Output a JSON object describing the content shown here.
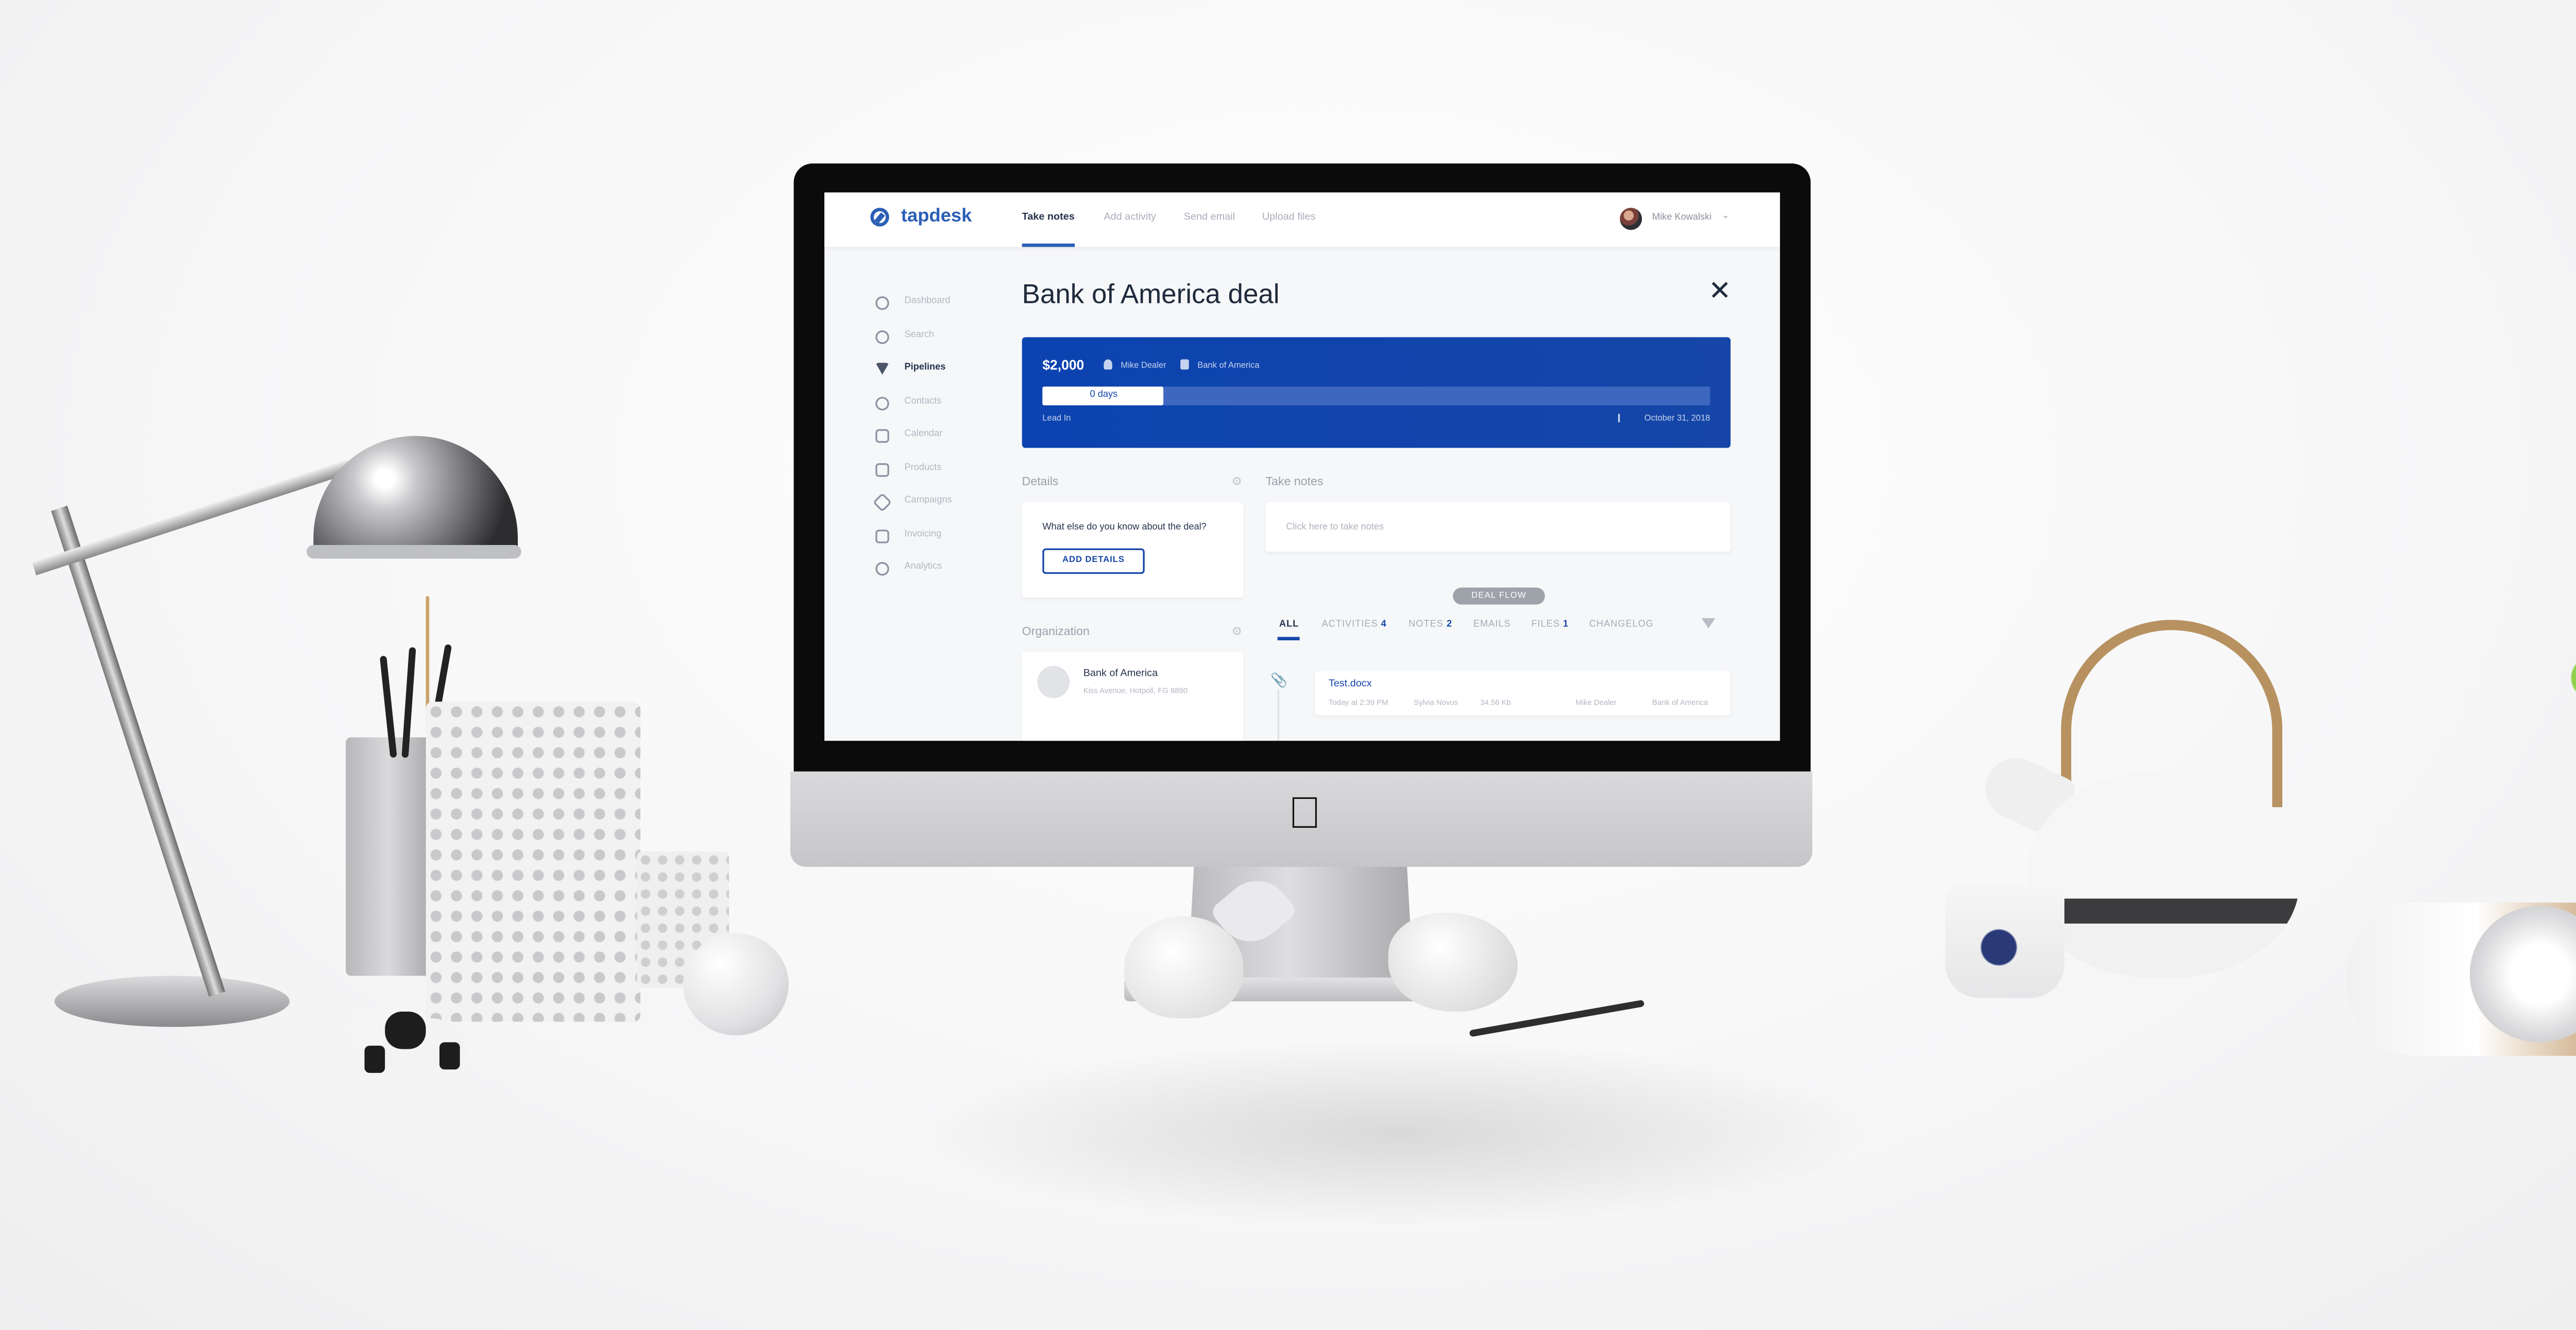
{
  "app": {
    "logo_text": "tapdesk",
    "brand_color": "#2b5fb6",
    "accent_color": "#1546a8"
  },
  "header": {
    "tabs": [
      {
        "label": "Take notes",
        "active": true
      },
      {
        "label": "Add activity",
        "active": false
      },
      {
        "label": "Send email",
        "active": false
      },
      {
        "label": "Upload files",
        "active": false
      }
    ],
    "user_name": "Mike Kowalski",
    "user_caret_icon": "chevron-down-icon"
  },
  "sidebar": {
    "items": [
      {
        "label": "Dashboard",
        "icon": "dashboard-icon",
        "active": false
      },
      {
        "label": "Search",
        "icon": "search-icon",
        "active": false
      },
      {
        "label": "Pipelines",
        "icon": "funnel-icon",
        "active": true
      },
      {
        "label": "Contacts",
        "icon": "contacts-icon",
        "active": false
      },
      {
        "label": "Calendar",
        "icon": "calendar-icon",
        "active": false
      },
      {
        "label": "Products",
        "icon": "box-icon",
        "active": false
      },
      {
        "label": "Campaigns",
        "icon": "send-icon",
        "active": false
      },
      {
        "label": "Invoicing",
        "icon": "invoice-icon",
        "active": false
      },
      {
        "label": "Analytics",
        "icon": "analytics-icon",
        "active": false
      }
    ]
  },
  "deal": {
    "title": "Bank of America deal",
    "amount": "$2,000",
    "owner": "Mike Dealer",
    "organization": "Bank of America",
    "progress_label": "0 days",
    "progress_fraction": 0.18,
    "stage": "Lead In",
    "close_date": "October 31, 2018"
  },
  "details": {
    "title": "Details",
    "question": "What else do you know about the deal?",
    "button_label": "ADD DETAILS"
  },
  "notes": {
    "title": "Take notes",
    "placeholder": "Click here to take notes"
  },
  "organization": {
    "title": "Organization",
    "name": "Bank of America",
    "address": "Kiss Avenue, Hotpoll, FG 8890"
  },
  "deal_flow": {
    "pill": "DEAL FLOW",
    "tabs": [
      {
        "label": "ALL",
        "count": "",
        "active": true
      },
      {
        "label": "ACTIVITIES",
        "count": "4",
        "active": false
      },
      {
        "label": "NOTES",
        "count": "2",
        "active": false
      },
      {
        "label": "EMAILS",
        "count": "",
        "active": false
      },
      {
        "label": "FILES",
        "count": "1",
        "active": false
      },
      {
        "label": "CHANGELOG",
        "count": "",
        "active": false
      }
    ],
    "file": {
      "name": "Test.docx",
      "time": "Today at 2:39 PM",
      "uploader": "Sylvia Novus",
      "size": "34.56 Kb",
      "owner": "Mike Dealer",
      "organization": "Bank of America"
    }
  }
}
